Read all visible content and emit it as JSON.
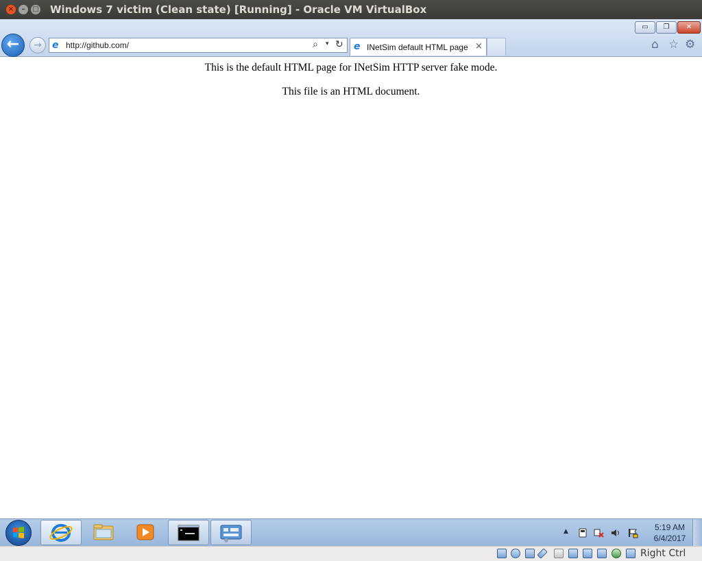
{
  "window": {
    "title": "Windows 7 victim (Clean state) [Running] - Oracle VM VirtualBox",
    "close_glyph": "×",
    "min_glyph": "–",
    "max_glyph": "□"
  },
  "ie": {
    "window_controls": {
      "min": "▭",
      "restore": "❐",
      "close": "✕"
    },
    "back_glyph": "←",
    "forward_glyph": "→",
    "address": {
      "url": "http://github.com/",
      "search_glyph": "⌕",
      "dropdown_glyph": "▾",
      "refresh_glyph": "↻"
    },
    "tab": {
      "label": "INetSim default HTML page",
      "close_glyph": "×"
    },
    "toolbar": {
      "home_glyph": "⌂",
      "favorites_glyph": "☆",
      "tools_glyph": "⚙"
    },
    "ie_glyph": "e"
  },
  "page": {
    "line1": "This is the default HTML page for INetSim HTTP server fake mode.",
    "line2": "This file is an HTML document."
  },
  "taskbar": {
    "items": [
      "internet-explorer",
      "windows-explorer",
      "windows-media-player",
      "command-prompt",
      "control-panel"
    ],
    "ie_glyph": "e",
    "cmd_glyph": "C:\\_",
    "tray": {
      "up_arrow": "▲",
      "clock_time": "5:19 AM",
      "clock_date": "6/4/2017"
    }
  },
  "statusbar": {
    "host_key": "Right Ctrl"
  },
  "colors": {
    "ubuntu_orange": "#e95420",
    "ie_blue": "#1f7bd8",
    "taskbar": "#98b6dc"
  }
}
